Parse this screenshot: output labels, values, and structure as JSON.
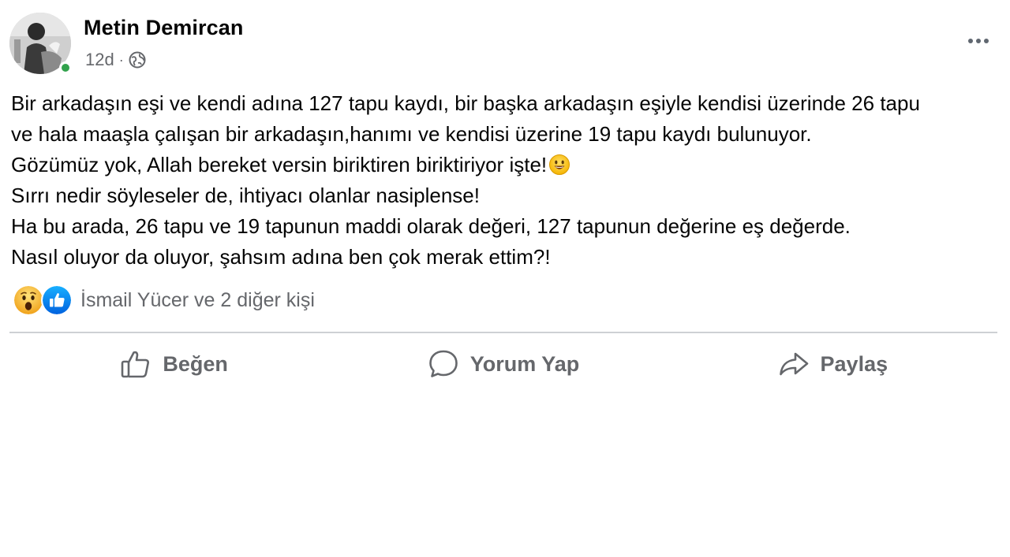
{
  "post": {
    "author": "Metin Demircan",
    "timestamp": "12d",
    "separator": "·",
    "audience_icon": "globe-icon",
    "more_icon": "more-options-icon",
    "online_status_color": "#31a24c",
    "body_lines": [
      "Bir arkadaşın eşi ve kendi adına 127 tapu kaydı, bir başka arkadaşın eşiyle kendisi üzerinde 26 tapu",
      "ve hala maaşla çalışan bir arkadaşın,hanımı ve kendisi üzerine 19 tapu  kaydı bulunuyor.",
      "Gözümüz yok, Allah bereket versin biriktiren biriktiriyor işte!",
      "Sırrı nedir söyleseler de, ihtiyacı olanlar nasiplense!",
      "Ha bu arada,  26 tapu ve 19 tapunun maddi olarak değeri, 127 tapunun değerine eş değerde.",
      "Nasıl oluyor da oluyor, şahsım adına ben çok merak ettim?!"
    ],
    "inline_emoji": "smiling-face-emoji",
    "reactions": {
      "icons": [
        "wow-reaction-icon",
        "like-reaction-icon"
      ],
      "summary": "İsmail Yücer ve 2 diğer kişi",
      "like_color": "#1877f2",
      "wow_color": "#f7b928"
    },
    "actions": {
      "like": "Beğen",
      "comment": "Yorum Yap",
      "share": "Paylaş"
    },
    "colors": {
      "text": "#050505",
      "secondary": "#65676b",
      "divider": "#ced0d4"
    }
  }
}
